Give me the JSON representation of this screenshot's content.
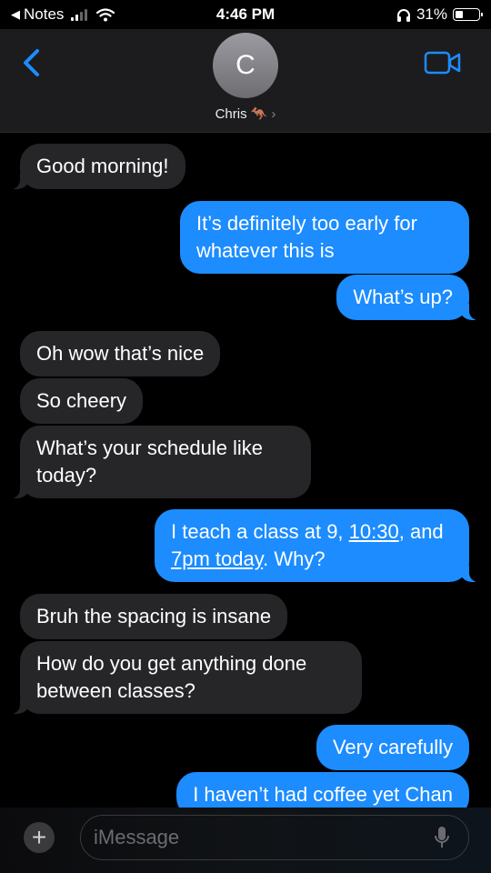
{
  "status_bar": {
    "back_app": "Notes",
    "time": "4:46 PM",
    "battery": "31%"
  },
  "header": {
    "avatar_initial": "C",
    "contact_name": "Chris 🦘",
    "chevron": "›"
  },
  "messages": [
    {
      "dir": "in",
      "text": "Good morning!"
    },
    {
      "dir": "out",
      "text": "It’s definitely too early for whatever this is"
    },
    {
      "dir": "out",
      "text": "What’s up?"
    },
    {
      "dir": "in",
      "text": "Oh wow that’s nice"
    },
    {
      "dir": "in",
      "text": "So cheery"
    },
    {
      "dir": "in",
      "text": "What’s your schedule like today?"
    },
    {
      "dir": "out",
      "parts": [
        "I teach a class at 9, ",
        "10:30",
        ", and ",
        "7pm today",
        ". Why?"
      ]
    },
    {
      "dir": "in",
      "text": "Bruh the spacing is insane"
    },
    {
      "dir": "in",
      "text": "How do you get anything done between classes?"
    },
    {
      "dir": "out",
      "text": "Very carefully"
    },
    {
      "dir": "out",
      "text": "I haven’t had coffee yet Chan"
    }
  ],
  "compose": {
    "plus": "+",
    "placeholder": "iMessage"
  },
  "colors": {
    "incoming_bubble": "#262629",
    "outgoing_bubble": "#1c8cff",
    "accent": "#1c8cff"
  },
  "icons": [
    "signal-icon",
    "wifi-icon",
    "headphones-icon",
    "battery-icon",
    "back-chevron-icon",
    "video-call-icon",
    "microphone-icon"
  ]
}
